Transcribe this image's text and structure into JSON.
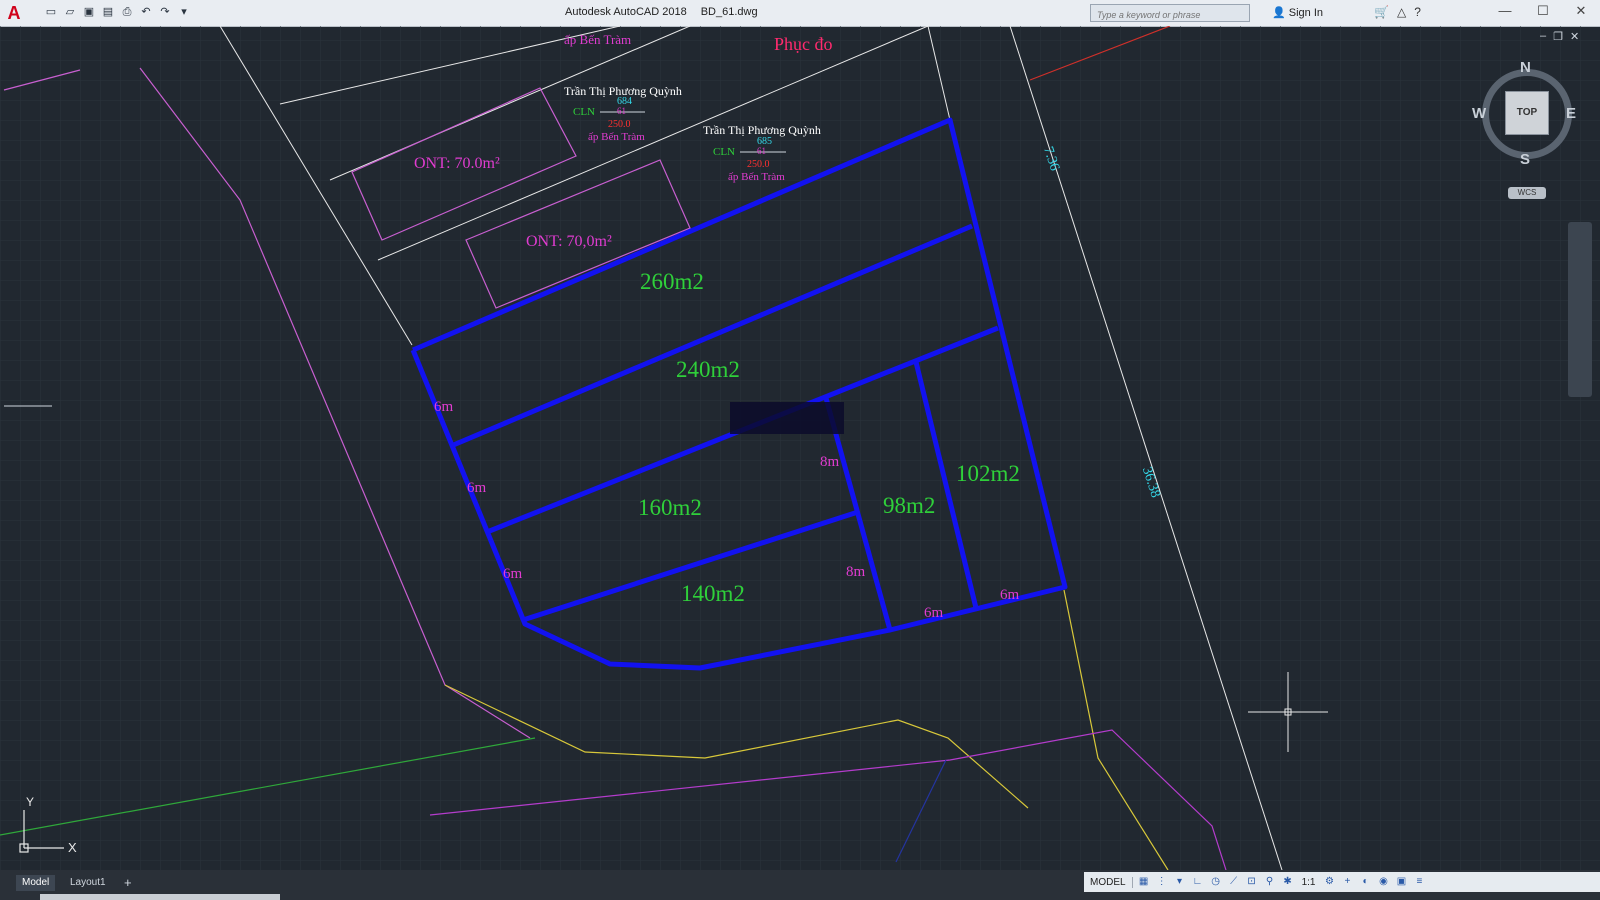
{
  "window": {
    "app_name": "Autodesk AutoCAD 2018",
    "file_name": "BD_61.dwg",
    "search_placeholder": "Type a keyword or phrase",
    "sign_in": "Sign In"
  },
  "viewcube": {
    "n": "N",
    "s": "S",
    "e": "E",
    "w": "W",
    "face": "TOP",
    "ucs": "WCS"
  },
  "drawing": {
    "top_label_1": "ấp Bến Tràm",
    "region_label": "Phục đo",
    "owner_1": "Trần Thị Phương Quỳnh",
    "owner_1_code": "CLN",
    "owner_1_parcel": "684",
    "owner_1_sheet": "61",
    "owner_1_area": "250.0",
    "owner_1_place": "ấp Bến Tràm",
    "owner_2": "Trần Thị Phương Quỳnh",
    "owner_2_code": "CLN",
    "owner_2_parcel": "685",
    "owner_2_sheet": "61",
    "owner_2_area": "250.0",
    "owner_2_place": "ấp Bến Tràm",
    "ont_1": "ONT: 70.0m²",
    "ont_2": "ONT: 70,0m²",
    "road_dim_1": "7.36",
    "road_dim_2": "36.38",
    "lots": {
      "a": "260m2",
      "b": "240m2",
      "c": "160m2",
      "d": "140m2",
      "e": "98m2",
      "f": "102m2"
    },
    "dims": {
      "w1": "6m",
      "w2": "6m",
      "w3": "6m",
      "d1": "8m",
      "d2": "8m",
      "b1": "6m",
      "b2": "6m"
    },
    "axis_y": "Y",
    "axis_x": "X"
  },
  "tabs": {
    "model": "Model",
    "layout1": "Layout1",
    "add": "+"
  },
  "status": {
    "model_label": "MODEL",
    "scale": "1:1"
  }
}
